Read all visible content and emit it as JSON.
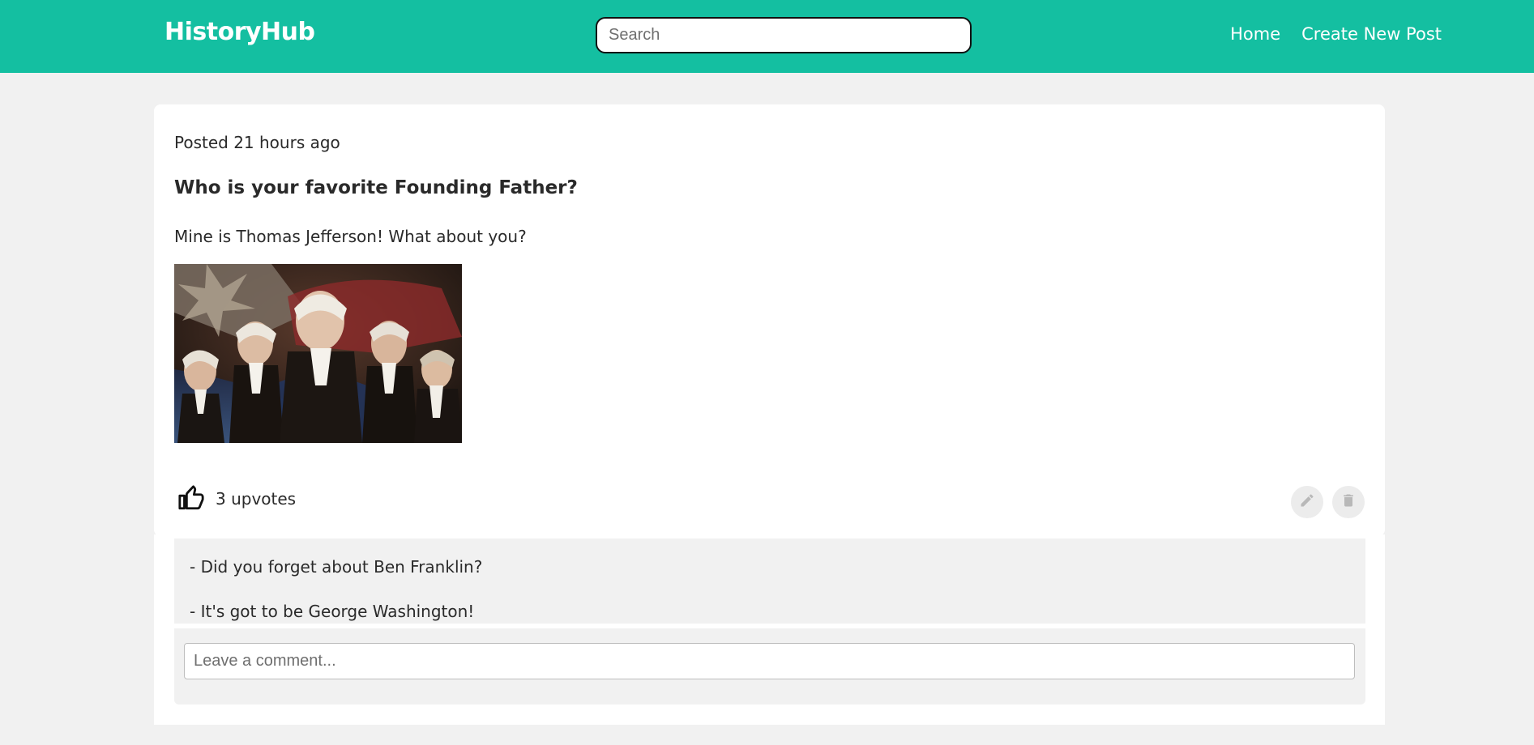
{
  "navbar": {
    "brand": "HistoryHub",
    "search_placeholder": "Search",
    "links": [
      "Home",
      "Create New Post"
    ]
  },
  "post": {
    "posted": "Posted 21 hours ago",
    "title": "Who is your favorite Founding Father?",
    "body": "Mine is Thomas Jefferson! What about you?",
    "upvotes": "3 upvotes",
    "comments": [
      "- Did you forget about Ben Franklin?",
      "- It's got to be George Washington!"
    ],
    "comment_placeholder": "Leave a comment..."
  },
  "colors": {
    "accent": "#14bfa1",
    "background": "#f1f1f1"
  },
  "icons": [
    "thumbs-up-icon",
    "pencil-icon",
    "trash-icon"
  ]
}
